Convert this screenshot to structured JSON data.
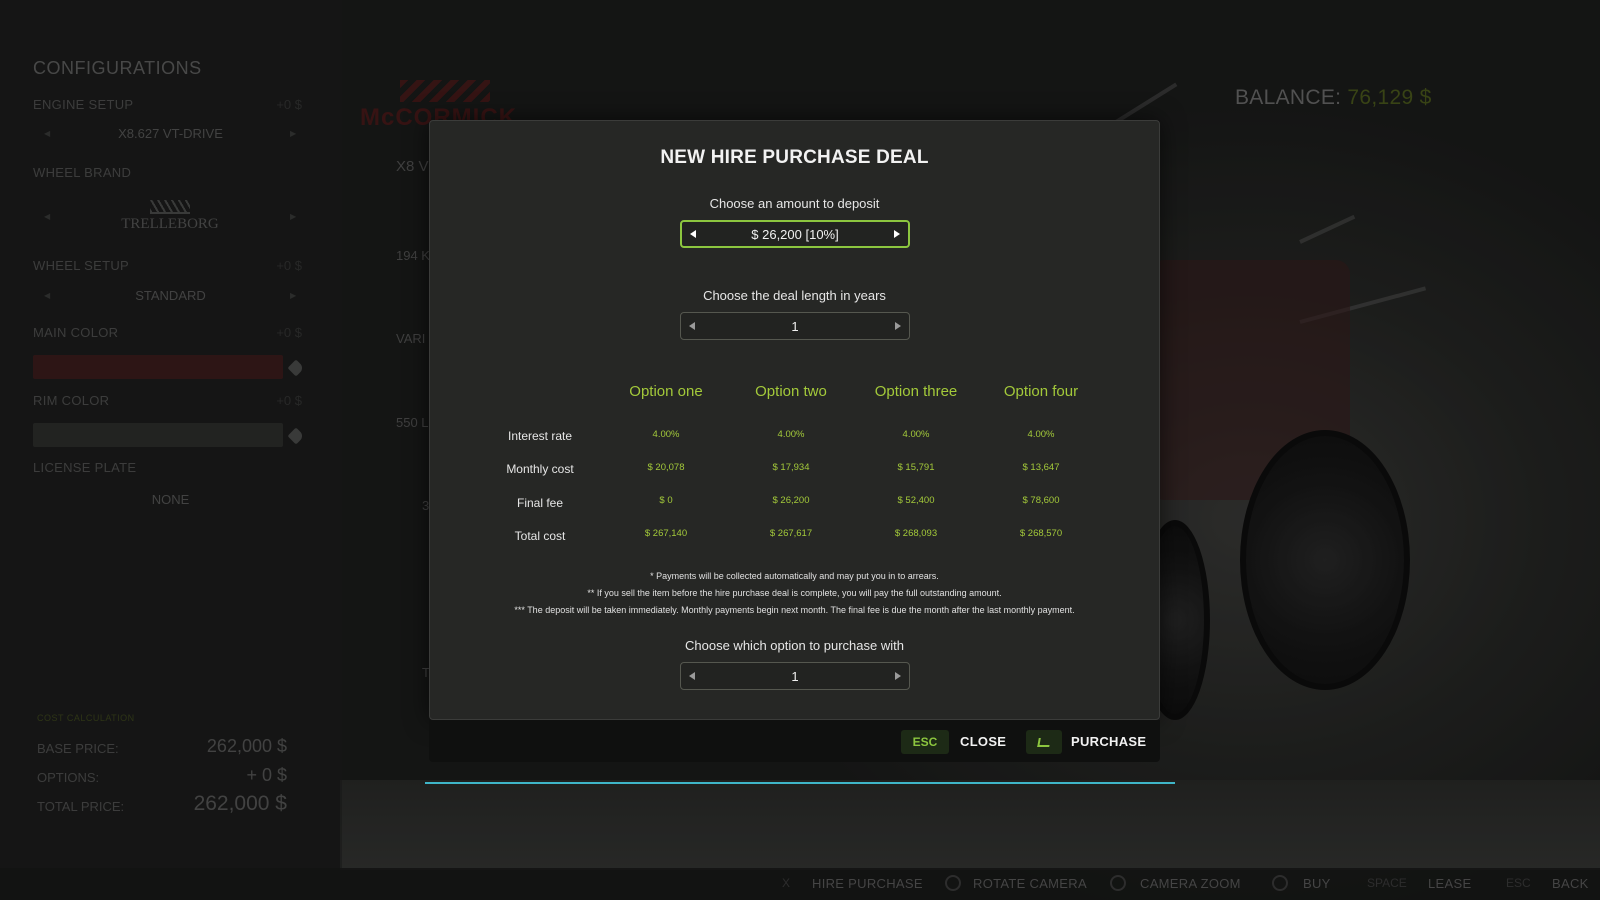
{
  "config": {
    "title": "CONFIGURATIONS",
    "sections": [
      {
        "label": "ENGINE SETUP",
        "price": "+0 $",
        "value": "X8.627 VT-DRIVE"
      },
      {
        "label": "WHEEL BRAND",
        "price": "",
        "value": "TRELLEBORG"
      },
      {
        "label": "WHEEL SETUP",
        "price": "+0 $",
        "value": "STANDARD"
      },
      {
        "label": "MAIN COLOR",
        "price": "+0 $",
        "value": ""
      },
      {
        "label": "RIM COLOR",
        "price": "+0 $",
        "value": ""
      },
      {
        "label": "LICENSE PLATE",
        "price": "",
        "value": "NONE"
      }
    ],
    "main_color": "#5a1e1e",
    "rim_color": "#3e3f3d",
    "cost": {
      "heading": "COST CALCULATION",
      "base_label": "BASE PRICE:",
      "base_value": "262,000 $",
      "options_label": "OPTIONS:",
      "options_value": "+ 0 $",
      "total_label": "TOTAL PRICE:",
      "total_value": "262,000 $"
    }
  },
  "vehicle": {
    "brand": "McCORMICK",
    "model_partial": "X8 V",
    "spec1": "194 K",
    "spec2": "VARI",
    "spec3": "550 L",
    "spec4": "3",
    "spec5": "T"
  },
  "balance": {
    "label": "BALANCE:",
    "amount": "76,129 $"
  },
  "modal": {
    "title": "NEW HIRE PURCHASE DEAL",
    "deposit_label": "Choose an amount to deposit",
    "deposit_value": "$ 26,200 [10%]",
    "length_label": "Choose the deal length in years",
    "length_value": "1",
    "options": [
      "Option one",
      "Option two",
      "Option three",
      "Option four"
    ],
    "rows": [
      {
        "label": "Interest rate",
        "values": [
          "4.00%",
          "4.00%",
          "4.00%",
          "4.00%"
        ]
      },
      {
        "label": "Monthly cost",
        "values": [
          "$ 20,078",
          "$ 17,934",
          "$ 15,791",
          "$ 13,647"
        ]
      },
      {
        "label": "Final fee",
        "values": [
          "$ 0",
          "$ 26,200",
          "$ 52,400",
          "$ 78,600"
        ]
      },
      {
        "label": "Total cost",
        "values": [
          "$ 267,140",
          "$ 267,617",
          "$ 268,093",
          "$ 268,570"
        ]
      }
    ],
    "notes": [
      "* Payments will be collected automatically and may put you in to arrears.",
      "** If you sell the item before the hire purchase deal is complete, you will pay the full outstanding amount.",
      "*** The deposit will be taken immediately. Monthly payments begin next month. The final fee is due the month after the last monthly payment."
    ],
    "option_label": "Choose which option to purchase with",
    "option_value": "1",
    "accent": "#8cc63f",
    "buttons": {
      "close_key": "ESC",
      "close_label": "CLOSE",
      "purchase_label": "PURCHASE"
    }
  },
  "hints": {
    "hire_key": "X",
    "hire_label": "HIRE PURCHASE",
    "rotate_label": "ROTATE CAMERA",
    "zoom_label": "CAMERA ZOOM",
    "buy_label": "BUY",
    "lease_key": "SPACE",
    "lease_label": "LEASE",
    "back_key": "ESC",
    "back_label": "BACK"
  }
}
